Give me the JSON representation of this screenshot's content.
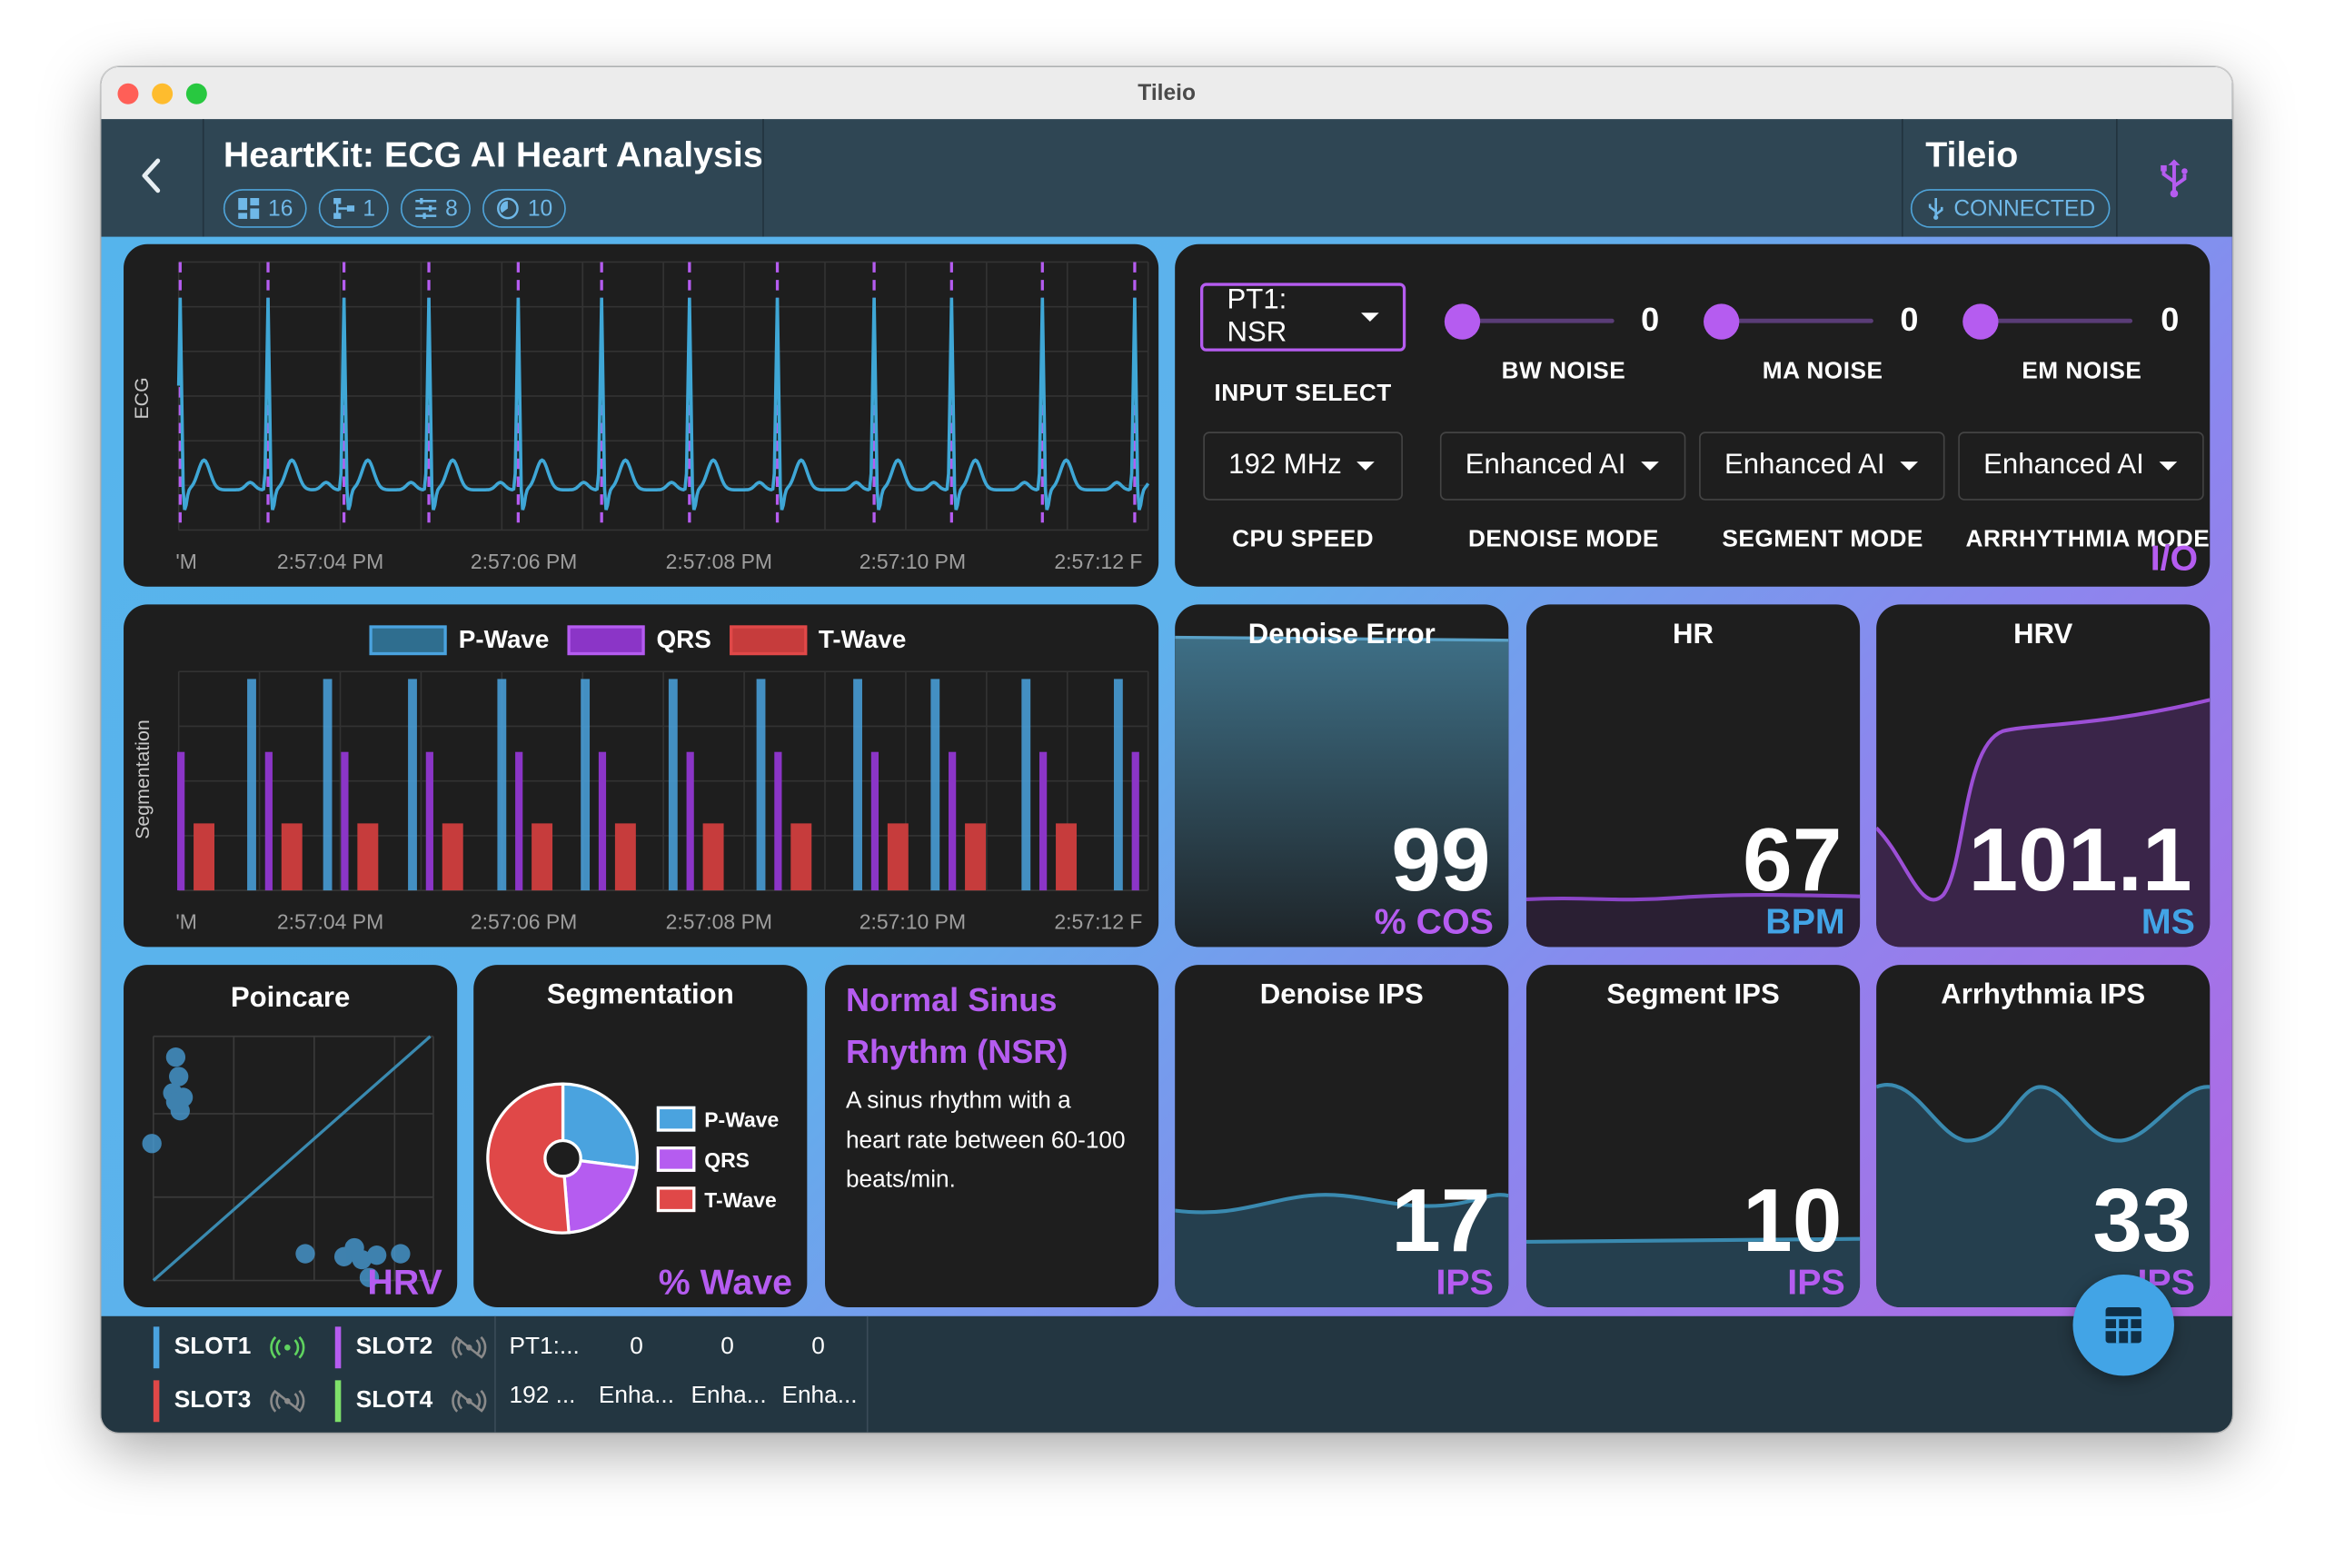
{
  "window": {
    "title": "Tileio"
  },
  "header": {
    "title": "HeartKit: ECG AI Heart Analysis",
    "chips": [
      {
        "icon": "dashboard-icon",
        "count": "16"
      },
      {
        "icon": "tree-icon",
        "count": "1"
      },
      {
        "icon": "sliders-icon",
        "count": "8"
      },
      {
        "icon": "timer-icon",
        "count": "10"
      }
    ],
    "device_name": "Tileio",
    "connection_status": "CONNECTED"
  },
  "ecg_chart": {
    "ylabel": "ECG",
    "ticks": [
      "'M",
      "2:57:04 PM",
      "2:57:06 PM",
      "2:57:08 PM",
      "2:57:10 PM",
      "2:57:12 F"
    ]
  },
  "controls": {
    "input_select": {
      "value": "PT1: NSR",
      "label": "INPUT SELECT"
    },
    "sliders": [
      {
        "label": "BW NOISE",
        "value": "0"
      },
      {
        "label": "MA NOISE",
        "value": "0"
      },
      {
        "label": "EM NOISE",
        "value": "0"
      }
    ],
    "dropdowns": [
      {
        "value": "192 MHz",
        "label": "CPU SPEED"
      },
      {
        "value": "Enhanced AI",
        "label": "DENOISE MODE"
      },
      {
        "value": "Enhanced AI",
        "label": "SEGMENT MODE"
      },
      {
        "value": "Enhanced AI",
        "label": "ARRHYTHMIA MODE"
      }
    ],
    "corner_label": "I/O"
  },
  "segmentation_chart": {
    "ylabel": "Segmentation",
    "legend": [
      "P-Wave",
      "QRS",
      "T-Wave"
    ],
    "ticks": [
      "'M",
      "2:57:04 PM",
      "2:57:06 PM",
      "2:57:08 PM",
      "2:57:10 PM",
      "2:57:12 F"
    ]
  },
  "metrics": {
    "denoise_error": {
      "title": "Denoise Error",
      "value": "99",
      "unit": "% COS"
    },
    "hr": {
      "title": "HR",
      "value": "67",
      "unit": "BPM"
    },
    "hrv": {
      "title": "HRV",
      "value": "101.1",
      "unit": "MS"
    },
    "denoise_ips": {
      "title": "Denoise IPS",
      "value": "17",
      "unit": "IPS"
    },
    "segment_ips": {
      "title": "Segment IPS",
      "value": "10",
      "unit": "IPS"
    },
    "arrhythmia_ips": {
      "title": "Arrhythmia IPS",
      "value": "33",
      "unit": "IPS"
    }
  },
  "poincare": {
    "title": "Poincare",
    "unit": "HRV"
  },
  "segmentation_pie": {
    "title": "Segmentation",
    "unit": "% Wave",
    "legend": [
      "P-Wave",
      "QRS",
      "T-Wave"
    ]
  },
  "rhythm": {
    "title": "Normal Sinus Rhythm (NSR)",
    "description": "A sinus rhythm with a heart rate between 60-100 beats/min."
  },
  "footer": {
    "slots": [
      {
        "name": "SLOT1",
        "color": "#4aa3df",
        "active": true
      },
      {
        "name": "SLOT2",
        "color": "#b55cf0",
        "active": false
      },
      {
        "name": "SLOT3",
        "color": "#e04848",
        "active": false
      },
      {
        "name": "SLOT4",
        "color": "#7ee06a",
        "active": false
      }
    ],
    "row1": [
      "PT1:...",
      "0",
      "0",
      "0"
    ],
    "row2": [
      "192 ...",
      "Enha...",
      "Enha...",
      "Enha..."
    ]
  },
  "colors": {
    "p_wave": "#4aa3df",
    "qrs": "#b55cf0",
    "t_wave": "#e04848",
    "ecg_line": "#3fa7d6",
    "accent_purple": "#b55cf0",
    "accent_blue": "#42a4e6"
  }
}
